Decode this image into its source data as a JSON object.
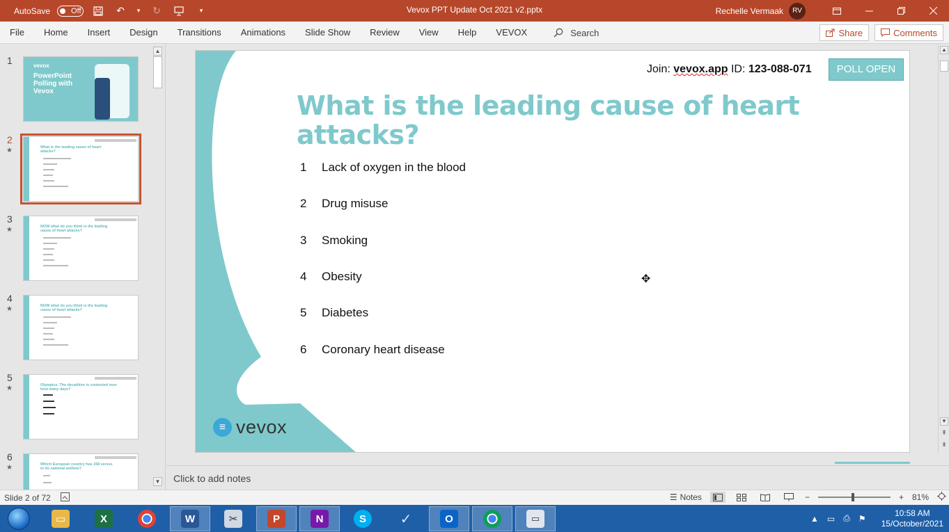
{
  "titlebar": {
    "autosave_label": "AutoSave",
    "autosave_state": "Off",
    "document_title": "Vevox PPT Update Oct 2021 v2.pptx",
    "user_name": "Rechelle Vermaak",
    "user_initials": "RV",
    "accent_color": "#b7472a"
  },
  "ribbon": {
    "tabs": [
      "File",
      "Home",
      "Insert",
      "Design",
      "Transitions",
      "Animations",
      "Slide Show",
      "Review",
      "View",
      "Help",
      "VEVOX"
    ],
    "search_label": "Search",
    "share_label": "Share",
    "comments_label": "Comments"
  },
  "thumbnails": [
    {
      "number": "1",
      "starred": false,
      "title": "PowerPoint Polling with Vevox",
      "brand": "vevox"
    },
    {
      "number": "2",
      "starred": true,
      "title": "What is the leading cause of heart attacks?"
    },
    {
      "number": "3",
      "starred": true,
      "title": "NOW what do you think is the leading cause of heart attacks?"
    },
    {
      "number": "4",
      "starred": true,
      "title": "NOW what do you think is the leading cause of heart attacks?"
    },
    {
      "number": "5",
      "starred": true,
      "title": "Olympics: The decathlon is contested over how many days?"
    },
    {
      "number": "6",
      "starred": true,
      "title": "Which European country has 158 verses to its national anthem?"
    }
  ],
  "slide": {
    "join_prefix": "Join: ",
    "join_url": "vevox.app",
    "join_id_label": " ID: ",
    "join_id": "123-088-071",
    "poll_status": "POLL OPEN",
    "question": "What is the leading cause of heart attacks?",
    "answers": [
      {
        "number": "1",
        "text": "Lack of oxygen in the blood"
      },
      {
        "number": "2",
        "text": "Drug misuse"
      },
      {
        "number": "3",
        "text": "Smoking"
      },
      {
        "number": "4",
        "text": "Obesity"
      },
      {
        "number": "5",
        "text": "Diabetes"
      },
      {
        "number": "6",
        "text": "Coronary heart disease"
      }
    ],
    "logo_text": "vevox",
    "theme_color": "#7fc9cc"
  },
  "notes": {
    "placeholder": "Click to add notes"
  },
  "statusbar": {
    "slide_counter": "Slide 2 of 72",
    "notes_label": "Notes",
    "zoom_level": "81%"
  },
  "taskbar": {
    "apps": [
      "file-explorer",
      "excel",
      "chrome",
      "word",
      "snipping-tool",
      "powerpoint",
      "onenote",
      "skype",
      "vevox",
      "outlook",
      "chrome-profile",
      "remote-desktop"
    ],
    "time": "10:58 AM",
    "date": "15/October/2021"
  }
}
